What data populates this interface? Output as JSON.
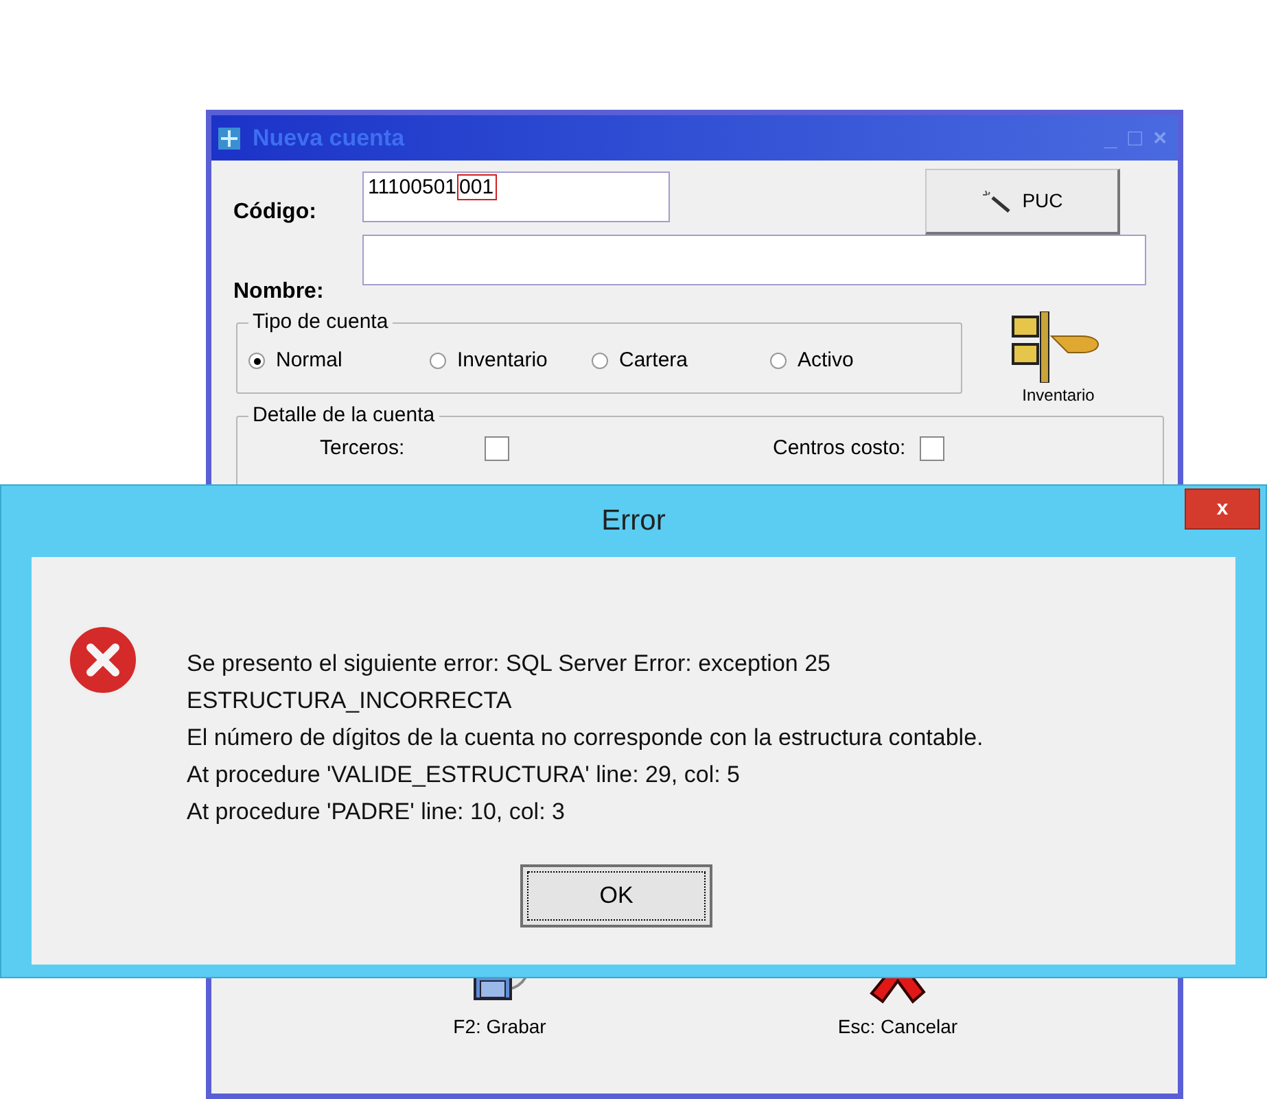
{
  "back_window": {
    "title": "Nueva cuenta",
    "title_buttons": [
      "_",
      "□",
      "×"
    ],
    "codigo": {
      "label": "Código:",
      "value": "11100501",
      "highlighted": "001"
    },
    "puc_button": "PUC",
    "nombre": {
      "label": "Nombre:"
    },
    "tipo_de_cuenta": {
      "title": "Tipo de cuenta",
      "options": [
        {
          "label": "Normal",
          "selected": true
        },
        {
          "label": "Inventario",
          "selected": false
        },
        {
          "label": "Cartera",
          "selected": false
        },
        {
          "label": "Activo",
          "selected": false
        }
      ]
    },
    "inventario_button": "Inventario",
    "detalle": {
      "title": "Detalle de la cuenta",
      "checkboxes": [
        {
          "label": "Terceros:",
          "checked": false
        },
        {
          "label": "Centros costo:",
          "checked": false
        }
      ]
    },
    "footer_buttons": [
      {
        "kind": "save",
        "label": "F2: Grabar"
      },
      {
        "kind": "cancel",
        "label": "Esc: Cancelar"
      }
    ]
  },
  "error_dialog": {
    "title": "Error",
    "close": "x",
    "message": [
      "Se presento el siguiente error: SQL Server Error: exception 25",
      "ESTRUCTURA_INCORRECTA",
      "El número de dígitos de la cuenta no corresponde con la estructura contable.",
      "At procedure 'VALIDE_ESTRUCTURA' line: 29, col: 5",
      "At procedure 'PADRE' line: 10, col: 3"
    ],
    "ok_button": "OK"
  }
}
